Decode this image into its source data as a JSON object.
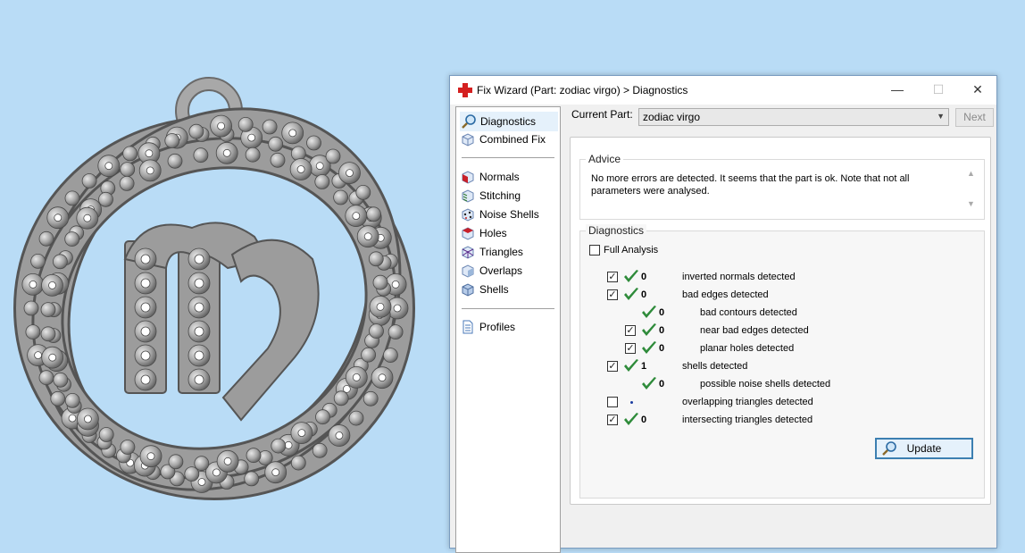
{
  "window": {
    "title": "Fix Wizard (Part: zodiac virgo) > Diagnostics",
    "minimize_glyph": "—",
    "maximize_glyph": "☐",
    "close_glyph": "✕"
  },
  "nav": {
    "items": [
      {
        "label": "Diagnostics",
        "icon": "magnifier-icon"
      },
      {
        "label": "Combined Fix",
        "icon": "cube-icon"
      },
      {
        "label": "Normals",
        "icon": "normals-cube-icon"
      },
      {
        "label": "Stitching",
        "icon": "stitching-cube-icon"
      },
      {
        "label": "Noise Shells",
        "icon": "noise-cube-icon"
      },
      {
        "label": "Holes",
        "icon": "holes-cube-icon"
      },
      {
        "label": "Triangles",
        "icon": "triangles-cube-icon"
      },
      {
        "label": "Overlaps",
        "icon": "overlaps-cube-icon"
      },
      {
        "label": "Shells",
        "icon": "shells-cube-icon"
      },
      {
        "label": "Profiles",
        "icon": "document-icon"
      }
    ],
    "selected": "Diagnostics"
  },
  "current_part": {
    "label": "Current Part:",
    "value": "zodiac virgo",
    "next_label": "Next"
  },
  "advice": {
    "title": "Advice",
    "text": "No more errors are detected. It seems that the part is ok. Note that not all parameters were analysed."
  },
  "diagnostics": {
    "title": "Diagnostics",
    "full_analysis_label": "Full Analysis",
    "full_analysis_checked": false,
    "rows": [
      {
        "checkbox": true,
        "checked": true,
        "status": "ok",
        "count": "0",
        "label": "inverted normals detected",
        "indent": 0
      },
      {
        "checkbox": true,
        "checked": true,
        "status": "ok",
        "count": "0",
        "label": "bad edges detected",
        "indent": 0
      },
      {
        "checkbox": false,
        "checked": false,
        "status": "ok",
        "count": "0",
        "label": "bad contours detected",
        "indent": 1
      },
      {
        "checkbox": true,
        "checked": true,
        "status": "ok",
        "count": "0",
        "label": "near bad edges detected",
        "indent": 1
      },
      {
        "checkbox": true,
        "checked": true,
        "status": "ok",
        "count": "0",
        "label": "planar holes detected",
        "indent": 1
      },
      {
        "checkbox": true,
        "checked": true,
        "status": "ok",
        "count": "1",
        "label": "shells detected",
        "indent": 0
      },
      {
        "checkbox": false,
        "checked": false,
        "status": "ok",
        "count": "0",
        "label": "possible noise shells detected",
        "indent": 1
      },
      {
        "checkbox": true,
        "checked": false,
        "status": "pending",
        "count": "",
        "label": "overlapping triangles detected",
        "indent": 0
      },
      {
        "checkbox": true,
        "checked": true,
        "status": "ok",
        "count": "0",
        "label": "intersecting triangles detected",
        "indent": 0
      }
    ],
    "update_label": "Update"
  },
  "colors": {
    "background": "#b9dcf6",
    "check_green": "#2e8b3a",
    "model_gray": "#9a9a9a"
  }
}
